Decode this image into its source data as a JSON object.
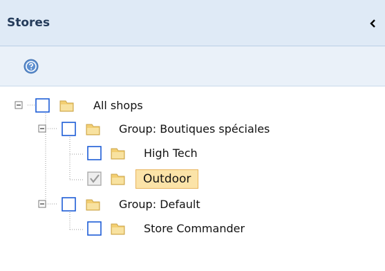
{
  "header": {
    "title": "Stores"
  },
  "toolbar": {
    "help_icon": "help-icon"
  },
  "tree": {
    "root": {
      "label": "All shops",
      "checked": false
    },
    "groups": [
      {
        "label": "Group: Boutiques spéciales",
        "checked": false,
        "shops": [
          {
            "label": "High Tech",
            "checked": false,
            "selected": false
          },
          {
            "label": "Outdoor",
            "checked": true,
            "selected": true
          }
        ]
      },
      {
        "label": "Group: Default",
        "checked": false,
        "shops": [
          {
            "label": "Store Commander",
            "checked": false,
            "selected": false
          }
        ]
      }
    ]
  },
  "colors": {
    "header_bg": "#dfeaf6",
    "toolbar_bg": "#eaf1f9",
    "checkbox_border": "#1c5bd6",
    "folder": "#f3cf72",
    "selection_bg": "#fbe3a8"
  }
}
